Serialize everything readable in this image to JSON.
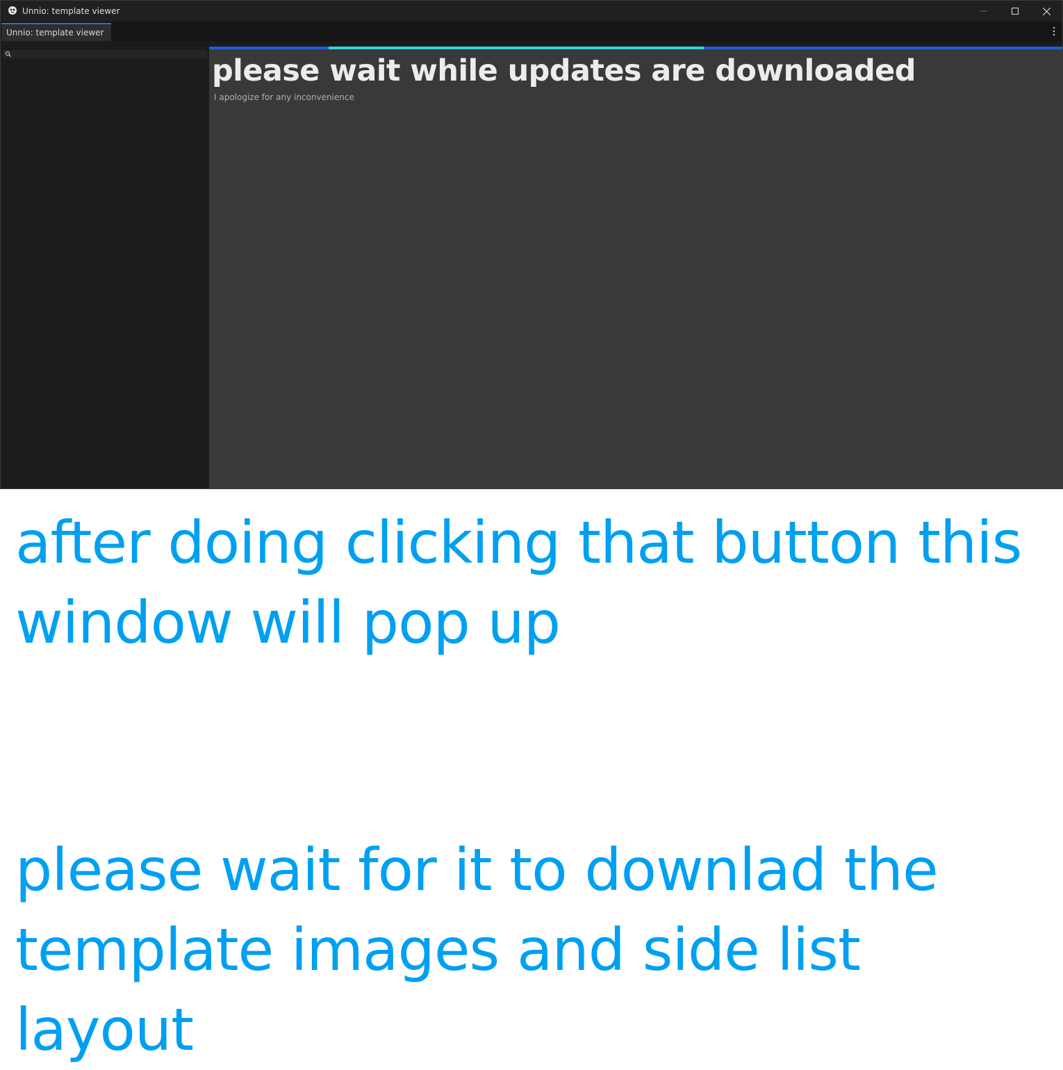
{
  "window": {
    "title": "Unnio: template viewer",
    "controls": {
      "minimize_icon": "minimize-icon",
      "maximize_icon": "maximize-icon",
      "close_icon": "close-icon"
    }
  },
  "tabs": [
    {
      "label": "Unnio: template viewer",
      "active": true
    }
  ],
  "sidebar": {
    "search_placeholder": "",
    "search_icon": "search-icon"
  },
  "main": {
    "progress_fraction": 0.57,
    "headline": "please wait while updates are downloaded",
    "subtext": "I apologize for any inconvenience"
  },
  "annotation": {
    "text_1": "after doing clicking that button this window will pop up",
    "text_2": "please wait for it to downlad the template images and side list layout"
  },
  "colors": {
    "titlebar": "#202020",
    "sidebar": "#1c1c1c",
    "content": "#393939",
    "progress_track": "#1f5fd6",
    "progress_fill": "#2fd6d6",
    "annotation_text": "#00a0f0"
  }
}
